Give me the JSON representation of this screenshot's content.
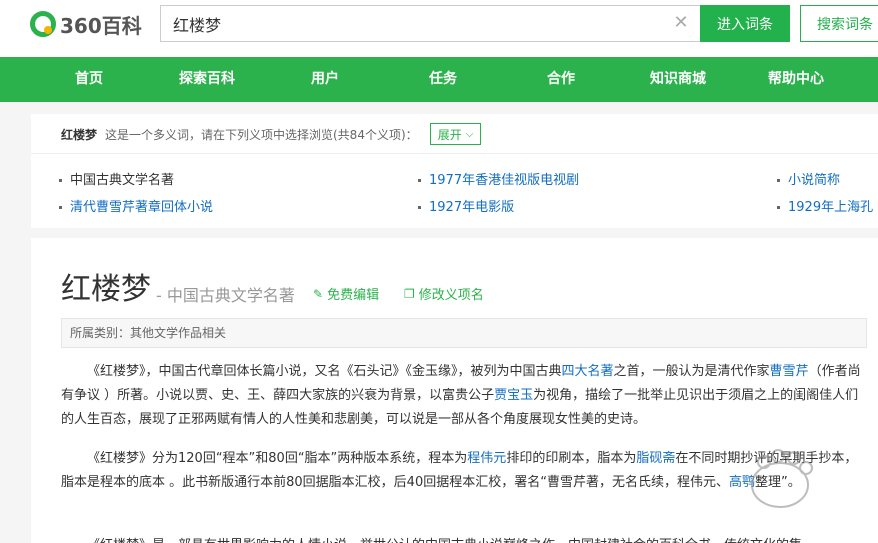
{
  "header": {
    "logo_text": "360百科",
    "search_value": "红楼梦",
    "enter_label": "进入词条",
    "search_label": "搜索词条"
  },
  "nav": {
    "items": [
      "首页",
      "探索百科",
      "用户",
      "任务",
      "合作",
      "知识商城",
      "帮助中心"
    ]
  },
  "disambiguation": {
    "term": "红楼梦",
    "description": "这是一个多义词，请在下列义项中选择浏览(共84个义项)：",
    "expand_label": "展开",
    "senses": [
      "中国古典文学名著",
      "1977年香港佳视版电视剧",
      "小说简称",
      "清代曹雪芹著章回体小说",
      "1927年电影版",
      "1929年上海孔"
    ]
  },
  "article": {
    "title": "红楼梦",
    "subtitle": "- 中国古典文学名著",
    "edit_label": "免费编辑",
    "modify_label": "修改义项名",
    "category": "所属类别：其他文学作品相关",
    "p1": {
      "t1": "《红楼梦》，中国古代章回体长篇小说，又名《石头记》《金玉缘》，被列为中国古典",
      "l1": "四大名著",
      "t2": "之首，一般认为是清代作家",
      "l2": "曹雪芹",
      "t3": "（作者尚有争议 ）所著。小说以贾、史、王、薛四大家族的兴衰为背景，以富贵公子",
      "l3": "贾宝玉",
      "t4": "为视角，描绘了一批举止见识出于须眉之上的闺阁佳人们的人生百态，展现了正邪两赋有情人的人性美和悲剧美，可以说是一部从各个角度展现女性美的史诗。"
    },
    "p2": {
      "t1": "《红楼梦》分为120回“程本”和80回“脂本”两种版本系统，程本为",
      "l1": "程伟元",
      "t2": "排印的印刷本，脂本为",
      "l2": "脂砚斋",
      "t3": "在不同时期抄评的早期手抄本，脂本是程本的底本 。此书新版通行本前80回据脂本汇校，后40回据程本汇校，署名“曹雪芹著，无名氏续，程伟元、",
      "l3": "高鹗",
      "t4": "整理”。"
    },
    "p3": "《红楼梦》是一部具有世界影响力的人情小说，举世公认的中国古典小说巅峰之作，中国封建社会的百科全书，传统文化的集"
  },
  "colors": {
    "brand_green": "#2bb24c",
    "link_blue": "#136ec2"
  }
}
